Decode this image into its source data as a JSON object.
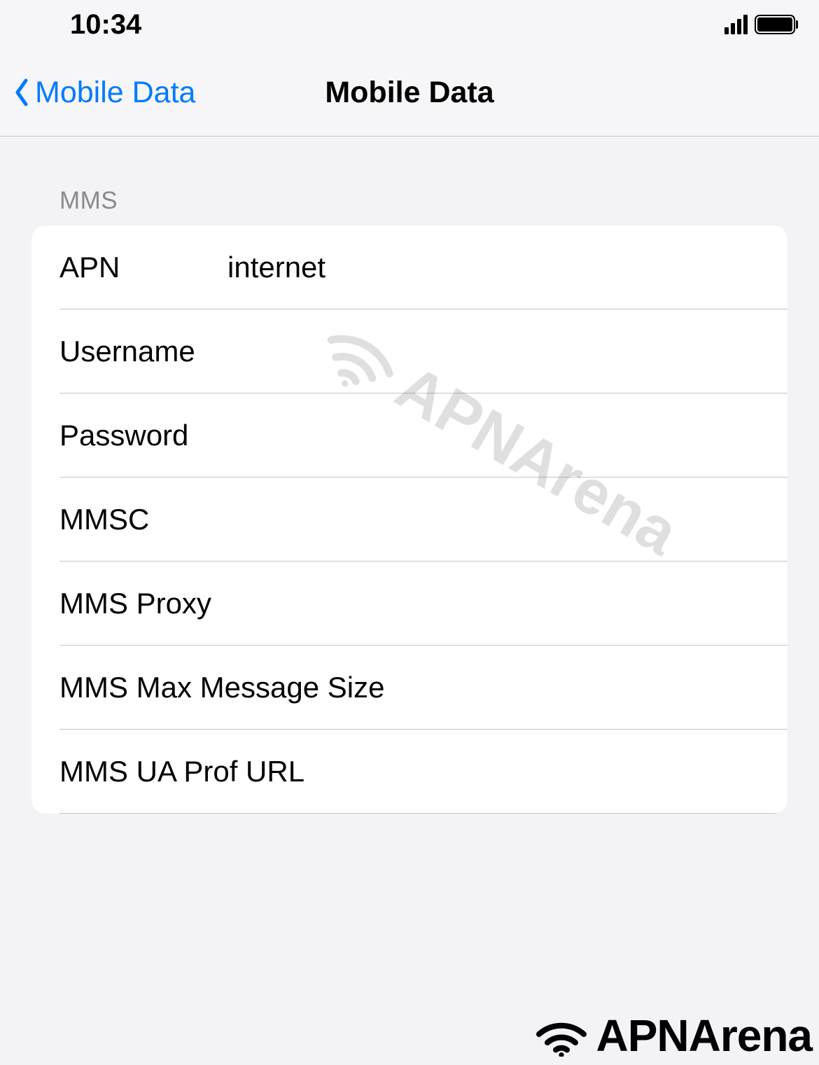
{
  "status_bar": {
    "time": "10:34"
  },
  "nav": {
    "back_label": "Mobile Data",
    "title": "Mobile Data"
  },
  "section": {
    "header": "MMS",
    "rows": [
      {
        "label": "APN",
        "value": "internet"
      },
      {
        "label": "Username",
        "value": ""
      },
      {
        "label": "Password",
        "value": ""
      },
      {
        "label": "MMSC",
        "value": ""
      },
      {
        "label": "MMS Proxy",
        "value": ""
      },
      {
        "label": "MMS Max Message Size",
        "value": ""
      },
      {
        "label": "MMS UA Prof URL",
        "value": ""
      }
    ]
  },
  "watermark": {
    "center_text": "APNArena",
    "bottom_text": "APNArena"
  }
}
